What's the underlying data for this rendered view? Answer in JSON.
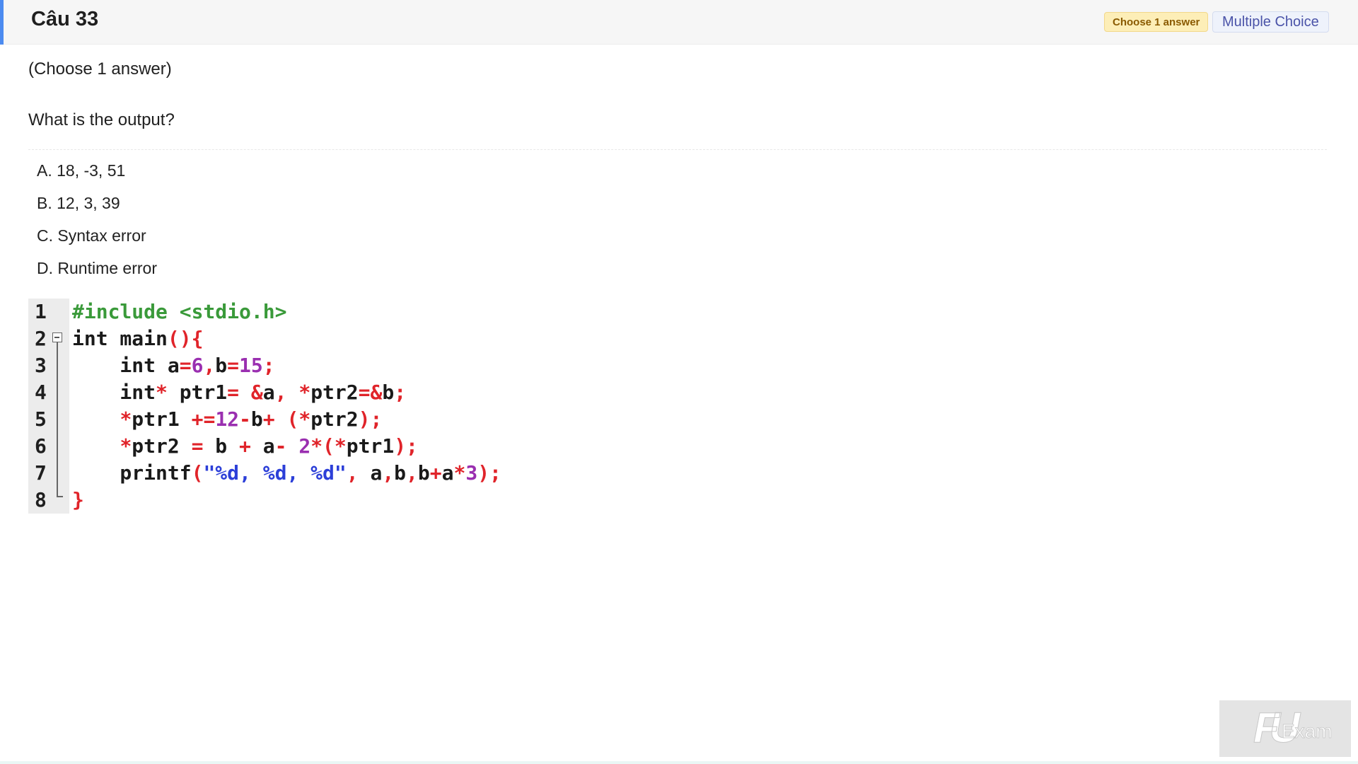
{
  "header": {
    "title": "Câu 33",
    "badge_answer_count": "Choose 1 answer",
    "badge_type": "Multiple Choice"
  },
  "question": {
    "instruction": "(Choose 1 answer)",
    "text": "What is the output?"
  },
  "options": [
    "A. 18, -3, 51",
    "B. 12, 3, 39",
    "C. Syntax error",
    "D. Runtime error"
  ],
  "code": {
    "line_numbers": [
      "1",
      "2",
      "3",
      "4",
      "5",
      "6",
      "7",
      "8"
    ],
    "lines": [
      [
        {
          "t": "#include <stdio.h>",
          "c": "g"
        }
      ],
      [
        {
          "t": "int main",
          "c": ""
        },
        {
          "t": "(){",
          "c": "r"
        }
      ],
      [
        {
          "t": "    int a",
          "c": ""
        },
        {
          "t": "=",
          "c": "r"
        },
        {
          "t": "6",
          "c": "p"
        },
        {
          "t": ",",
          "c": "r"
        },
        {
          "t": "b",
          "c": ""
        },
        {
          "t": "=",
          "c": "r"
        },
        {
          "t": "15",
          "c": "p"
        },
        {
          "t": ";",
          "c": "r"
        }
      ],
      [
        {
          "t": "    int",
          "c": ""
        },
        {
          "t": "*",
          "c": "r"
        },
        {
          "t": " ptr1",
          "c": ""
        },
        {
          "t": "=",
          "c": "r"
        },
        {
          "t": " ",
          "c": ""
        },
        {
          "t": "&",
          "c": "r"
        },
        {
          "t": "a",
          "c": ""
        },
        {
          "t": ",",
          "c": "r"
        },
        {
          "t": " ",
          "c": ""
        },
        {
          "t": "*",
          "c": "r"
        },
        {
          "t": "ptr2",
          "c": ""
        },
        {
          "t": "=&",
          "c": "r"
        },
        {
          "t": "b",
          "c": ""
        },
        {
          "t": ";",
          "c": "r"
        }
      ],
      [
        {
          "t": "    ",
          "c": ""
        },
        {
          "t": "*",
          "c": "r"
        },
        {
          "t": "ptr1 ",
          "c": ""
        },
        {
          "t": "+=",
          "c": "r"
        },
        {
          "t": "12",
          "c": "p"
        },
        {
          "t": "-",
          "c": "r"
        },
        {
          "t": "b",
          "c": ""
        },
        {
          "t": "+",
          "c": "r"
        },
        {
          "t": " ",
          "c": ""
        },
        {
          "t": "(*",
          "c": "r"
        },
        {
          "t": "ptr2",
          "c": ""
        },
        {
          "t": ");",
          "c": "r"
        }
      ],
      [
        {
          "t": "    ",
          "c": ""
        },
        {
          "t": "*",
          "c": "r"
        },
        {
          "t": "ptr2 ",
          "c": ""
        },
        {
          "t": "=",
          "c": "r"
        },
        {
          "t": " b ",
          "c": ""
        },
        {
          "t": "+",
          "c": "r"
        },
        {
          "t": " a",
          "c": ""
        },
        {
          "t": "-",
          "c": "r"
        },
        {
          "t": " ",
          "c": ""
        },
        {
          "t": "2",
          "c": "p"
        },
        {
          "t": "*(*",
          "c": "r"
        },
        {
          "t": "ptr1",
          "c": ""
        },
        {
          "t": ");",
          "c": "r"
        }
      ],
      [
        {
          "t": "    printf",
          "c": ""
        },
        {
          "t": "(",
          "c": "r"
        },
        {
          "t": "\"%d, %d, %d\"",
          "c": "b"
        },
        {
          "t": ",",
          "c": "r"
        },
        {
          "t": " a",
          "c": ""
        },
        {
          "t": ",",
          "c": "r"
        },
        {
          "t": "b",
          "c": ""
        },
        {
          "t": ",",
          "c": "r"
        },
        {
          "t": "b",
          "c": ""
        },
        {
          "t": "+",
          "c": "r"
        },
        {
          "t": "a",
          "c": ""
        },
        {
          "t": "*",
          "c": "r"
        },
        {
          "t": "3",
          "c": "p"
        },
        {
          "t": ");",
          "c": "r"
        }
      ],
      [
        {
          "t": "}",
          "c": "r"
        }
      ]
    ]
  },
  "watermark": {
    "logo_letters": "FU",
    "logo_word": "Exam"
  },
  "colors": {
    "accent": "#4c8bf0",
    "code_green": "#3a9a3a",
    "code_red": "#e0242a",
    "code_purple": "#9a2fb0",
    "code_blue": "#2c3fd8"
  }
}
